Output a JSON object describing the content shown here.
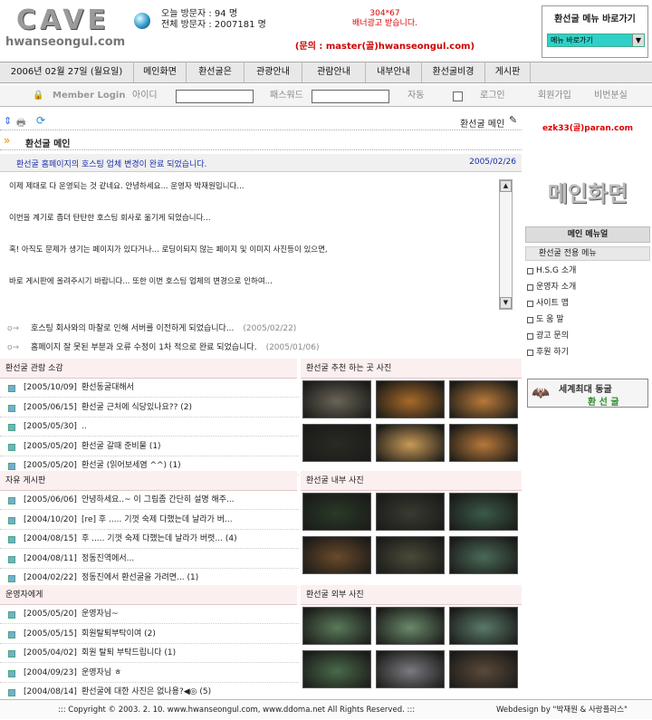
{
  "logo": {
    "big": "CAVE",
    "small": "hwanseongul.com"
  },
  "visitors": {
    "today_label": "오늘 방문자 :",
    "today": "94 명",
    "total_label": "전체 방문자 :",
    "total": "2007181 명"
  },
  "ad": {
    "size": "304*67",
    "text": "배너광고 받습니다.",
    "contact": "(문의 : master(골)hwanseongul.com)"
  },
  "quick": {
    "title": "환선굴 메뉴 바로가기",
    "select": "메뉴 바로가기"
  },
  "menu": {
    "date": "2006년 02월 27일 (월요일)",
    "items": [
      "메인화면",
      "환선굴은",
      "관광안내",
      "관람안내",
      "내부안내",
      "환선굴비경",
      "게시판"
    ]
  },
  "login": {
    "title": "Member Login",
    "id_label": "아이디",
    "pw_label": "패스워드",
    "auto_label": "자동",
    "login": "로그인",
    "join": "회원가입",
    "lost": "비번분실"
  },
  "toolbar": {
    "location": "환선굴 메인"
  },
  "page": {
    "title": "환선굴 메인"
  },
  "notice": {
    "title": "환선굴 홈페이지의 호스팅 업체 변경이 완료 되었습니다.",
    "date": "2005/02/26"
  },
  "body": [
    "이제 제대로 다 운영되는 것 같네요. 안녕하세요... 운영자 박재원입니다...",
    "이번을 계기로 좀더 탄탄한 호스팅 회사로 옮기게 되었습니다...",
    "혹! 아직도 문제가 생기는 페이지가 있다거나... 로딩이되지 않는 페이지 및 이미지 사진등이 있으면,",
    "바로 게시판에 올려주시기 바랍니다... 또한 이번 호스팅 업체의 변경으로 인하여..."
  ],
  "related": [
    {
      "title": "호스팅 회사와의 마찰로 인해 서버를 이전하게 되었습니다...",
      "date": "(2005/02/22)"
    },
    {
      "title": "홈페이지 잘 못된 부분과 오류 수정이 1차 적으로 완료 되었습니다.",
      "date": "(2005/01/06)"
    }
  ],
  "sections": [
    {
      "title": "환선굴 관람 소감",
      "photo_title": "환선굴 추천 하는 곳 사진",
      "rows": [
        {
          "date": "[2005/10/09]",
          "text": "환선동굴대해서"
        },
        {
          "date": "[2005/06/15]",
          "text": "환선굴 근처에 식당있나요??   (2)"
        },
        {
          "date": "[2005/05/30]",
          "text": ".."
        },
        {
          "date": "[2005/05/20]",
          "text": "환선굴 갈때 준비물   (1)"
        },
        {
          "date": "[2005/05/20]",
          "text": "환선굴 (읽어보세염 ^^)   (1)"
        }
      ]
    },
    {
      "title": "자유 게시판",
      "photo_title": "환선굴 내부 사진",
      "rows": [
        {
          "date": "[2005/06/06]",
          "text": "안녕하세요..~ 이 그림좀 간단히 설명 해주..."
        },
        {
          "date": "[2004/10/20]",
          "text": "[re] 후 ..... 기껏 숙제 다했는데 날라가 버..."
        },
        {
          "date": "[2004/08/15]",
          "text": "후 ..... 기껏 숙제 다했는데 날라가 버렷...   (4)"
        },
        {
          "date": "[2004/08/11]",
          "text": "정동진역에서..."
        },
        {
          "date": "[2004/02/22]",
          "text": "정동진에서 환선굴을 가려면...   (1)"
        }
      ]
    },
    {
      "title": "운영자에게",
      "photo_title": "환선굴 외부 사진",
      "rows": [
        {
          "date": "[2005/05/20]",
          "text": "운영자님~"
        },
        {
          "date": "[2005/05/15]",
          "text": "회원탈퇴부탁이여   (2)"
        },
        {
          "date": "[2005/04/02]",
          "text": "회원 탈퇴 부탁드립니다   (1)"
        },
        {
          "date": "[2004/09/23]",
          "text": "운영자님 ㅎ"
        },
        {
          "date": "[2004/08/14]",
          "text": "환선굴에 대한 사진은 없나용?◀◎   (5)"
        }
      ]
    }
  ],
  "footer": {
    "copyright": "::: Copyright © 2003. 2. 10. www.hwanseongul.com, www.ddoma.net All Rights Reserved. :::",
    "design": "Webdesign by \"박재원 & 사랑플러스\""
  },
  "side": {
    "email": "ezk33(골)paran.com",
    "main": "메인화면",
    "menu_title": "메인 메뉴얼",
    "group": "환선굴 전용 메뉴",
    "items": [
      "H.S.G 소개",
      "운영자 소개",
      "사이트 맵",
      "도 움 말",
      "광고 문의",
      "후원 하기"
    ],
    "banner1": "세계최대 동굴",
    "banner2": "환 선 굴"
  }
}
